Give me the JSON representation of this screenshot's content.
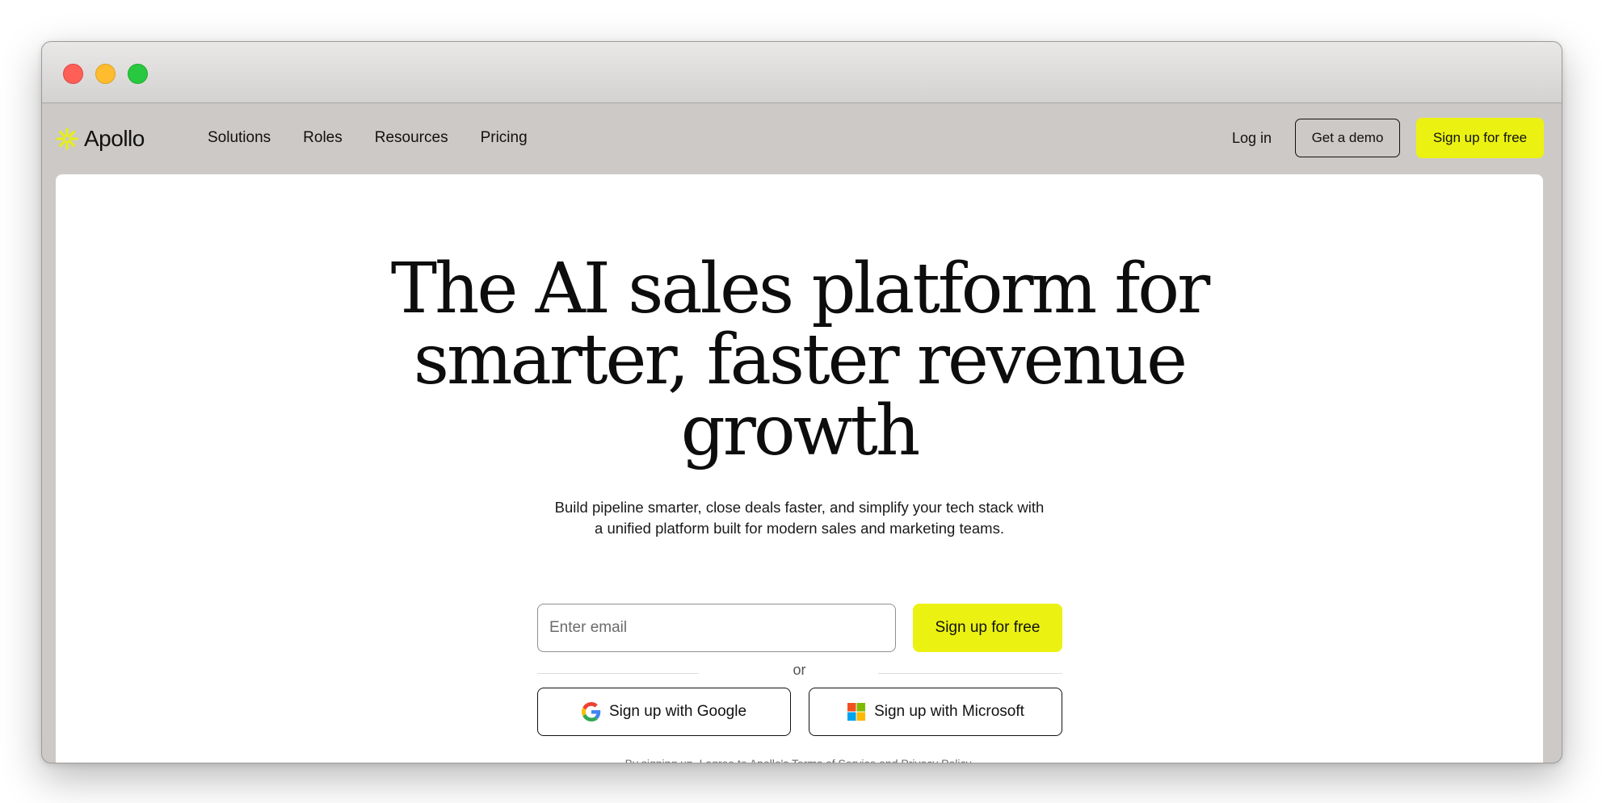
{
  "brand": {
    "name": "Apollo",
    "accent": "#ebf212"
  },
  "nav": {
    "links": [
      "Solutions",
      "Roles",
      "Resources",
      "Pricing"
    ],
    "login": "Log in",
    "demo": "Get a demo",
    "signup": "Sign up for free"
  },
  "hero": {
    "headline_lines": [
      "The AI sales platform for",
      "smarter, faster revenue",
      "growth"
    ],
    "subhead_lines": [
      "Build pipeline smarter, close deals faster, and simplify your tech stack with",
      "a unified platform built for modern sales and marketing teams."
    ],
    "email_placeholder": "Enter email",
    "signup_button": "Sign up for free",
    "or": "or",
    "google_button": "Sign up with Google",
    "microsoft_button": "Sign up with Microsoft",
    "legal": {
      "prefix": "By signing up, I agree to Apollo's",
      "terms": "Terms of Service",
      "and": "and",
      "privacy": "Privacy Policy",
      "suffix": "."
    }
  }
}
